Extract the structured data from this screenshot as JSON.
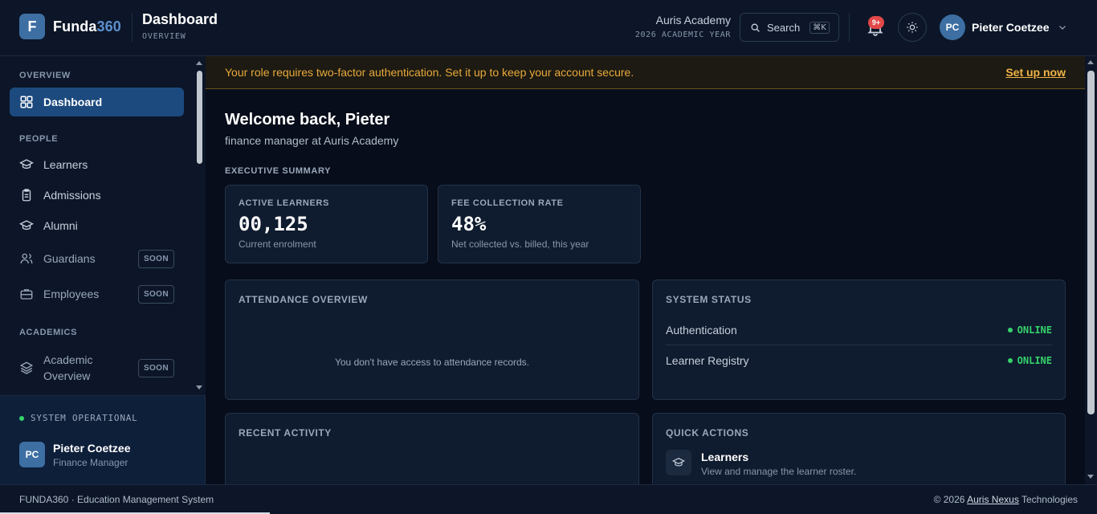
{
  "brand": {
    "logo_letter": "F",
    "name": "Funda",
    "name_num": "360"
  },
  "page": {
    "title": "Dashboard",
    "subtitle": "OVERVIEW"
  },
  "org": {
    "name": "Auris Academy",
    "year": "2026 ACADEMIC YEAR"
  },
  "search": {
    "label": "Search",
    "shortcut": "⌘K"
  },
  "notifications": {
    "badge": "9+"
  },
  "user": {
    "initials": "PC",
    "name": "Pieter Coetzee",
    "role": "Finance Manager"
  },
  "sidebar": {
    "sections": {
      "overview": "OVERVIEW",
      "people": "PEOPLE",
      "academics": "ACADEMICS"
    },
    "items": {
      "dashboard": "Dashboard",
      "learners": "Learners",
      "admissions": "Admissions",
      "alumni": "Alumni",
      "guardians": "Guardians",
      "employees": "Employees",
      "academic_overview_1": "Academic",
      "academic_overview_2": "Overview"
    },
    "soon_label": "SOON",
    "system_status": "SYSTEM OPERATIONAL"
  },
  "alert": {
    "message": "Your role requires two-factor authentication. Set it up to keep your account secure.",
    "action": "Set up now"
  },
  "welcome": {
    "title": "Welcome back, Pieter",
    "subtitle": "finance manager at Auris Academy"
  },
  "executive_summary": {
    "label": "EXECUTIVE SUMMARY",
    "kpis": [
      {
        "label": "ACTIVE LEARNERS",
        "value": "00,125",
        "sub": "Current enrolment"
      },
      {
        "label": "FEE COLLECTION RATE",
        "value": "48%",
        "sub": "Net collected vs. billed, this year"
      }
    ]
  },
  "attendance": {
    "title": "ATTENDANCE OVERVIEW",
    "message": "You don't have access to attendance records."
  },
  "system_status": {
    "title": "SYSTEM STATUS",
    "rows": [
      {
        "name": "Authentication",
        "status": "ONLINE"
      },
      {
        "name": "Learner Registry",
        "status": "ONLINE"
      }
    ]
  },
  "recent_activity": {
    "title": "RECENT ACTIVITY"
  },
  "quick_actions": {
    "title": "QUICK ACTIONS",
    "items": [
      {
        "title": "Learners",
        "desc": "View and manage the learner roster."
      }
    ]
  },
  "footer": {
    "left": "FUNDA360 · Education Management System",
    "copyright": "© 2026",
    "company_link": "Auris Nexus",
    "company_rest": "Technologies"
  },
  "colors": {
    "accent": "#1c4a7e",
    "brand": "#3d6fa3",
    "online": "#34d36b",
    "warning": "#e9a93b",
    "badge": "#e24848"
  }
}
